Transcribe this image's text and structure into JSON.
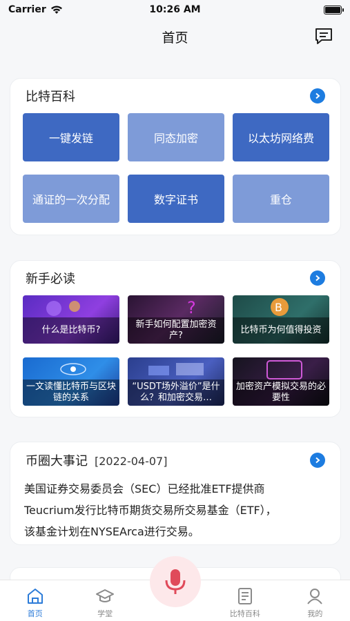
{
  "status_bar": {
    "carrier": "Carrier",
    "time": "10:26 AM"
  },
  "nav": {
    "title": "首页",
    "message_icon": "message-icon"
  },
  "encyclopedia": {
    "title": "比特百科",
    "items": [
      {
        "label": "一键发链",
        "tone": "dark"
      },
      {
        "label": "同态加密",
        "tone": "light"
      },
      {
        "label": "以太坊网络费",
        "tone": "dark"
      },
      {
        "label": "通证的一次分配",
        "tone": "light"
      },
      {
        "label": "数字证书",
        "tone": "dark"
      },
      {
        "label": "重仓",
        "tone": "light"
      }
    ]
  },
  "guides": {
    "title": "新手必读",
    "items": [
      {
        "caption": "什么是比特币?"
      },
      {
        "caption": "新手如何配置加密资产?"
      },
      {
        "caption": "比特币为何值得投资"
      },
      {
        "caption": "一文读懂比特币与区块链的关系"
      },
      {
        "caption": "“USDT场外溢价”是什么？和加密交易…"
      },
      {
        "caption": "加密资产模拟交易的必要性"
      }
    ]
  },
  "news": {
    "title": "币圈大事记",
    "date": "[2022-04-07]",
    "lines": [
      "美国证券交易委员会（SEC）已经批准ETF提供商",
      "Teucrium发行比特币期货交易所交易基金（ETF），",
      "该基金计划在NYSEArca进行交易。"
    ]
  },
  "tabs": [
    {
      "label": "首页",
      "icon": "home-icon",
      "active": true
    },
    {
      "label": "学堂",
      "icon": "graduation-cap-icon",
      "active": false
    },
    {
      "label": "比特百科",
      "icon": "book-icon",
      "active": false
    },
    {
      "label": "我的",
      "icon": "user-icon",
      "active": false
    }
  ],
  "colors": {
    "accent": "#2b7bd8",
    "tile_dark": "#3e69c2",
    "tile_light": "#7e9bd8",
    "mic": "#e04a5a"
  }
}
